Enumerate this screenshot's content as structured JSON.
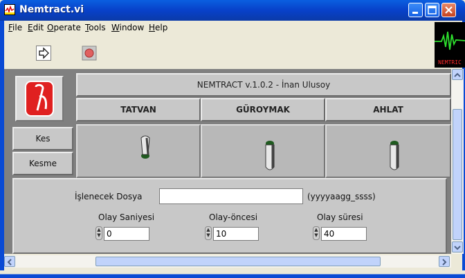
{
  "window": {
    "title": "Nemtract.vi",
    "controls": [
      "minimize",
      "maximize",
      "close"
    ]
  },
  "menu": {
    "items": [
      {
        "label": "File",
        "underline": "F"
      },
      {
        "label": "Edit",
        "underline": "E"
      },
      {
        "label": "Operate",
        "underline": "O"
      },
      {
        "label": "Tools",
        "underline": "T"
      },
      {
        "label": "Window",
        "underline": "W"
      },
      {
        "label": "Help",
        "underline": "H"
      }
    ]
  },
  "toolbar": {
    "run_icon": "run-arrow-icon",
    "stop_icon": "stop-icon",
    "logo_text": "NEMTRIC"
  },
  "panel": {
    "app_header": "NEMTRACT v.1.0.2 - İnan Ulusoy",
    "stations": [
      "TATVAN",
      "GÜROYMAK",
      "AHLAT"
    ],
    "kes_label": "Kes",
    "kesme_label": "Kesme",
    "switch_states": [
      "on",
      "off",
      "off"
    ],
    "file_label": "İşlenecek Dosya",
    "file_value": "",
    "file_format": "(yyyyaagg_ssss)",
    "fields": [
      {
        "label": "Olay Saniyesi",
        "value": "0"
      },
      {
        "label": "Olay-öncesi",
        "value": "10"
      },
      {
        "label": "Olay süresi",
        "value": "40"
      }
    ]
  },
  "colors": {
    "titlebar": "#0841c9",
    "panel_bg": "#808080",
    "logo_red": "#e02020"
  }
}
